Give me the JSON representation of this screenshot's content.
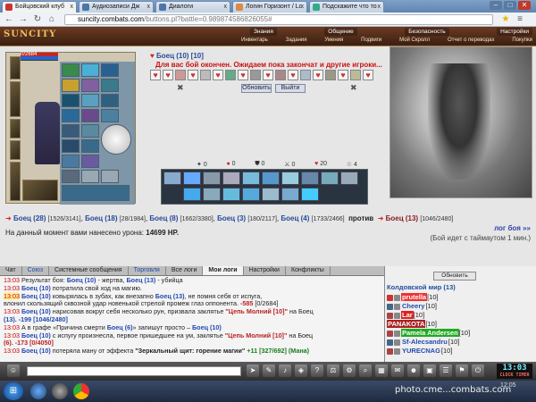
{
  "browser": {
    "tabs": [
      {
        "title": "Бойцовский клуб",
        "color": "#c33",
        "active": true
      },
      {
        "title": "Аудиозаписи Дж",
        "color": "#4a76a8",
        "active": false
      },
      {
        "title": "Диалоги",
        "color": "#4a76a8",
        "active": false
      },
      {
        "title": "Логин Горизонт / Lc",
        "color": "#d84",
        "active": false
      },
      {
        "title": "Подскажите что то",
        "color": "#3a8",
        "active": false
      }
    ],
    "url_host": "suncity.combats.com",
    "url_path": "/buttons.pl?battle=0.989874586826055#",
    "win_min": "–",
    "win_max": "□",
    "win_close": "✕",
    "nav_back": "←",
    "nav_fwd": "→",
    "nav_reload": "↻",
    "nav_home": "⌂",
    "tab_close": "x"
  },
  "site": {
    "logo": "SUNCITY",
    "top_menu": [
      "Знания",
      "Общение",
      "Безопасность",
      "Настройки"
    ],
    "sub_menu": [
      "Инвентарь",
      "Задания",
      "Умения",
      "Подвиги",
      "Мой Скролл",
      "Отчет о переводах",
      "Покупки"
    ]
  },
  "battle": {
    "player_hp": "0/2684",
    "player_mp": "333/4000",
    "enemy_name": "Боец (10) [10]",
    "message": "Для вас бой окончен. Ожидаем пока закончат и другие игроки...",
    "refresh_label": "Обновить",
    "exit_label": "Выйти",
    "stats": [
      "0",
      "0",
      "0",
      "0",
      "20",
      "4"
    ],
    "team1": [
      {
        "name": "Боец (28)",
        "stat": "[1526/3141]"
      },
      {
        "name": "Боец (18)",
        "stat": "[28/1984]"
      },
      {
        "name": "Боец (8)",
        "stat": "[1662/3380]"
      },
      {
        "name": "Боец (3)",
        "stat": "[180/2117]"
      },
      {
        "name": "Боец (4)",
        "stat": "[1733/2466]"
      }
    ],
    "versus": "против",
    "team2": [
      {
        "name": "Боец (13)",
        "stat": "[1046/2480]"
      }
    ],
    "damage_label": "На данный момент вами нанесено урона:",
    "damage_value": "14699 HP.",
    "next_log": "лог боя »»",
    "timeout": "(Бой идет с таймаутом 1 мин.)"
  },
  "chat": {
    "tabs": [
      {
        "label": "Чат",
        "style": "normal"
      },
      {
        "label": "Союз",
        "style": "blue"
      },
      {
        "label": "Системные сообщения",
        "style": "normal"
      },
      {
        "label": "Торговля",
        "style": "blue"
      },
      {
        "label": "Все логи",
        "style": "normal"
      },
      {
        "label": "Мои логи",
        "style": "sel"
      },
      {
        "label": "Настройки",
        "style": "normal"
      },
      {
        "label": "Конфликты",
        "style": "normal"
      }
    ],
    "lines": [
      {
        "time": "13:03",
        "text": "Результат боя: ",
        "name": "Боец (10)",
        "rest": " - жертва, ",
        "name2": "Боец (13)",
        "rest2": " - убийца"
      },
      {
        "time": "13:03",
        "text": "",
        "name": "Боец (10)",
        "rest": " потратила свой ход на магию.",
        "name2": "",
        "rest2": ""
      },
      {
        "time": "13:03",
        "text": "",
        "name": "Боец (10)",
        "rest": " ковырялась в зубах, как внезапно ",
        "name2": "Боец (13)",
        "rest2": ", не помня себя от испуга,"
      },
      {
        "time": "",
        "text": "влонил скользящий сквозной удар новенькой стрелой промеж глаз оппонента. ",
        "name": "",
        "rest": "-585",
        "name2": "",
        "rest2": " [0/2684]"
      },
      {
        "time": "13:03",
        "text": "",
        "name": "Боец (10)",
        "rest": " нарисовав вокруг себя несколько рун, призвала заклятье ",
        "name2": "\"Цепь Молний [10]\"",
        "rest2": " на Боец"
      },
      {
        "time": "",
        "text": "(13). -199 [1046/2480]",
        "name": "",
        "rest": "",
        "name2": "",
        "rest2": ""
      },
      {
        "time": "13:03",
        "text": "А в графе «Причина смерти ",
        "name": "Боец (6)",
        "rest": "» запишут просто – ",
        "name2": "Боец (10)",
        "rest2": ""
      },
      {
        "time": "13:03",
        "text": "",
        "name": "Боец (10)",
        "rest": " с испугу произнесла, первое пришедшее на ум, заклятье ",
        "name2": "\"Цепь Молний [10]\"",
        "rest2": " на Боец"
      },
      {
        "time": "",
        "text": "(6). -173 [0/4050]",
        "name": "",
        "rest": "",
        "name2": "",
        "rest2": ""
      },
      {
        "time": "13:03",
        "text": "",
        "name": "Боец (10)",
        "rest": " потеряла ману от эффекта ",
        "name2": "\"Зеркальный щит: горение магии\"",
        "rest2": " +11 [327/692] (Мана)"
      }
    ]
  },
  "right": {
    "refresh": "Обновить",
    "room": "Колдовской мир (13)",
    "users": [
      {
        "name": "prutella",
        "lvl": "[10]",
        "color": "#c33",
        "bg": "#e33"
      },
      {
        "name": "Cheery",
        "lvl": "[10]",
        "color": "#234ab0",
        "bg": "transparent"
      },
      {
        "name": "Lar",
        "lvl": "[10]",
        "color": "#fff",
        "bg": "#d22"
      },
      {
        "name": "PANAKOTA",
        "lvl": "[10]",
        "color": "#fff",
        "bg": "#a22"
      },
      {
        "name": "Pamela Andersen",
        "lvl": "[10]",
        "color": "#fff",
        "bg": "#2a2"
      },
      {
        "name": "Sf-Alecsandru",
        "lvl": "[10]",
        "color": "#234ab0",
        "bg": "transparent"
      },
      {
        "name": "YURECNAG",
        "lvl": "[10]",
        "color": "#234ab0",
        "bg": "transparent"
      }
    ]
  },
  "bottom": {
    "clock": "13:03",
    "clock_sub": "CLOCK TIMER"
  },
  "taskbar": {
    "start": "⊞",
    "watermark": "photo.cme...combats.com",
    "tray": "12:05"
  }
}
